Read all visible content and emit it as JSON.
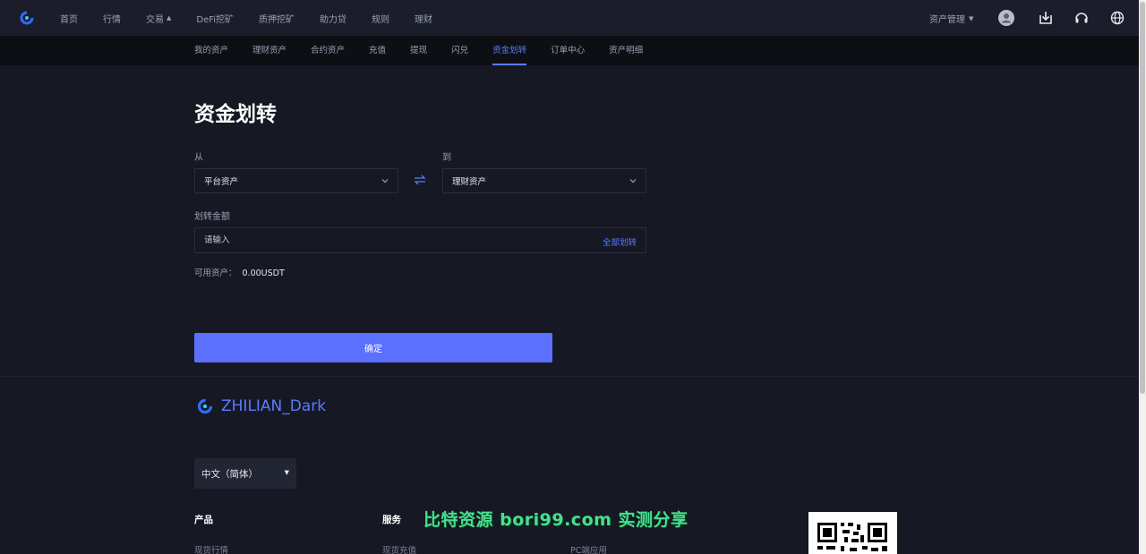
{
  "topnav": {
    "items": [
      {
        "label": "首页"
      },
      {
        "label": "行情"
      },
      {
        "label": "交易",
        "dropdown": true
      },
      {
        "label": "DeFi挖矿"
      },
      {
        "label": "质押挖矿"
      },
      {
        "label": "助力贷"
      },
      {
        "label": "规则"
      },
      {
        "label": "理财"
      }
    ],
    "asset_menu": "资产管理",
    "icons": [
      "user-avatar-icon",
      "download-icon",
      "headset-icon",
      "globe-icon"
    ]
  },
  "subnav": {
    "items": [
      {
        "label": "我的资产"
      },
      {
        "label": "理财资产"
      },
      {
        "label": "合约资产"
      },
      {
        "label": "充值"
      },
      {
        "label": "提现"
      },
      {
        "label": "闪兑"
      },
      {
        "label": "资金划转",
        "active": true
      },
      {
        "label": "订单中心"
      },
      {
        "label": "资产明细"
      }
    ]
  },
  "transfer": {
    "title": "资金划转",
    "from_label": "从",
    "from_value": "平台资产",
    "to_label": "到",
    "to_value": "理财资产",
    "amount_label": "划转金额",
    "amount_placeholder": "请输入",
    "amount_value": "",
    "transfer_all": "全部划转",
    "available_label": "可用资产：",
    "available_value": "0.00USDT",
    "confirm": "确定"
  },
  "footer": {
    "brand": "ZHILIAN_Dark",
    "language": "中文（简体）",
    "col1_head": "产品",
    "col1_link": "现货行情",
    "col2_head": "服务",
    "col2_link": "现货充值",
    "col3_link": "PC端应用"
  },
  "watermark": "比特资源 bori99.com 实测分享",
  "colors": {
    "accent": "#5b7bff",
    "button": "#5b70ff",
    "background": "#161924",
    "topbar": "#1b1e2a",
    "subbar": "#0d0f15",
    "watermark": "#46e08f"
  }
}
